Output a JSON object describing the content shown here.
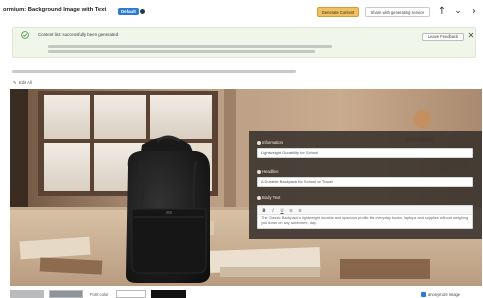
{
  "header": {
    "title": "ormium: Background Image with Text",
    "badge": "Default",
    "generate_button": "Generate Content",
    "share_button": "Share with generating service",
    "icons": [
      "arrow-up-icon",
      "chevron-down-icon",
      "chevron-right-icon"
    ]
  },
  "banner": {
    "message": "Content list: successfully been generated",
    "feedback_button": "Leave Feedback",
    "icons": [
      "check-circle-icon",
      "close-icon"
    ]
  },
  "toolbar": {
    "edit_all": "Edit All"
  },
  "panel": {
    "fields": [
      {
        "label": "Information",
        "value": "Lightweight Durability for School"
      },
      {
        "label": "Headline",
        "value": "A Durable Backpack for School or Travel"
      },
      {
        "label": "Body Text",
        "value": "The Classic Backpack's lightweight durable and spacious profile fits everyday books, laptops and supplies without weighing you down on any adventure, day."
      }
    ],
    "rte_buttons": [
      "B",
      "I",
      "U",
      "≡",
      "≡"
    ]
  },
  "bottom": {
    "font_label": "Font color",
    "checkbox_label": "anonymize image"
  },
  "colors": {
    "accent_orange": "#f0c065",
    "badge_blue": "#2a7bd1",
    "banner_green": "#f1f6ea",
    "panel_dark": "#342e2a",
    "backpack": "#1b1b1b"
  }
}
